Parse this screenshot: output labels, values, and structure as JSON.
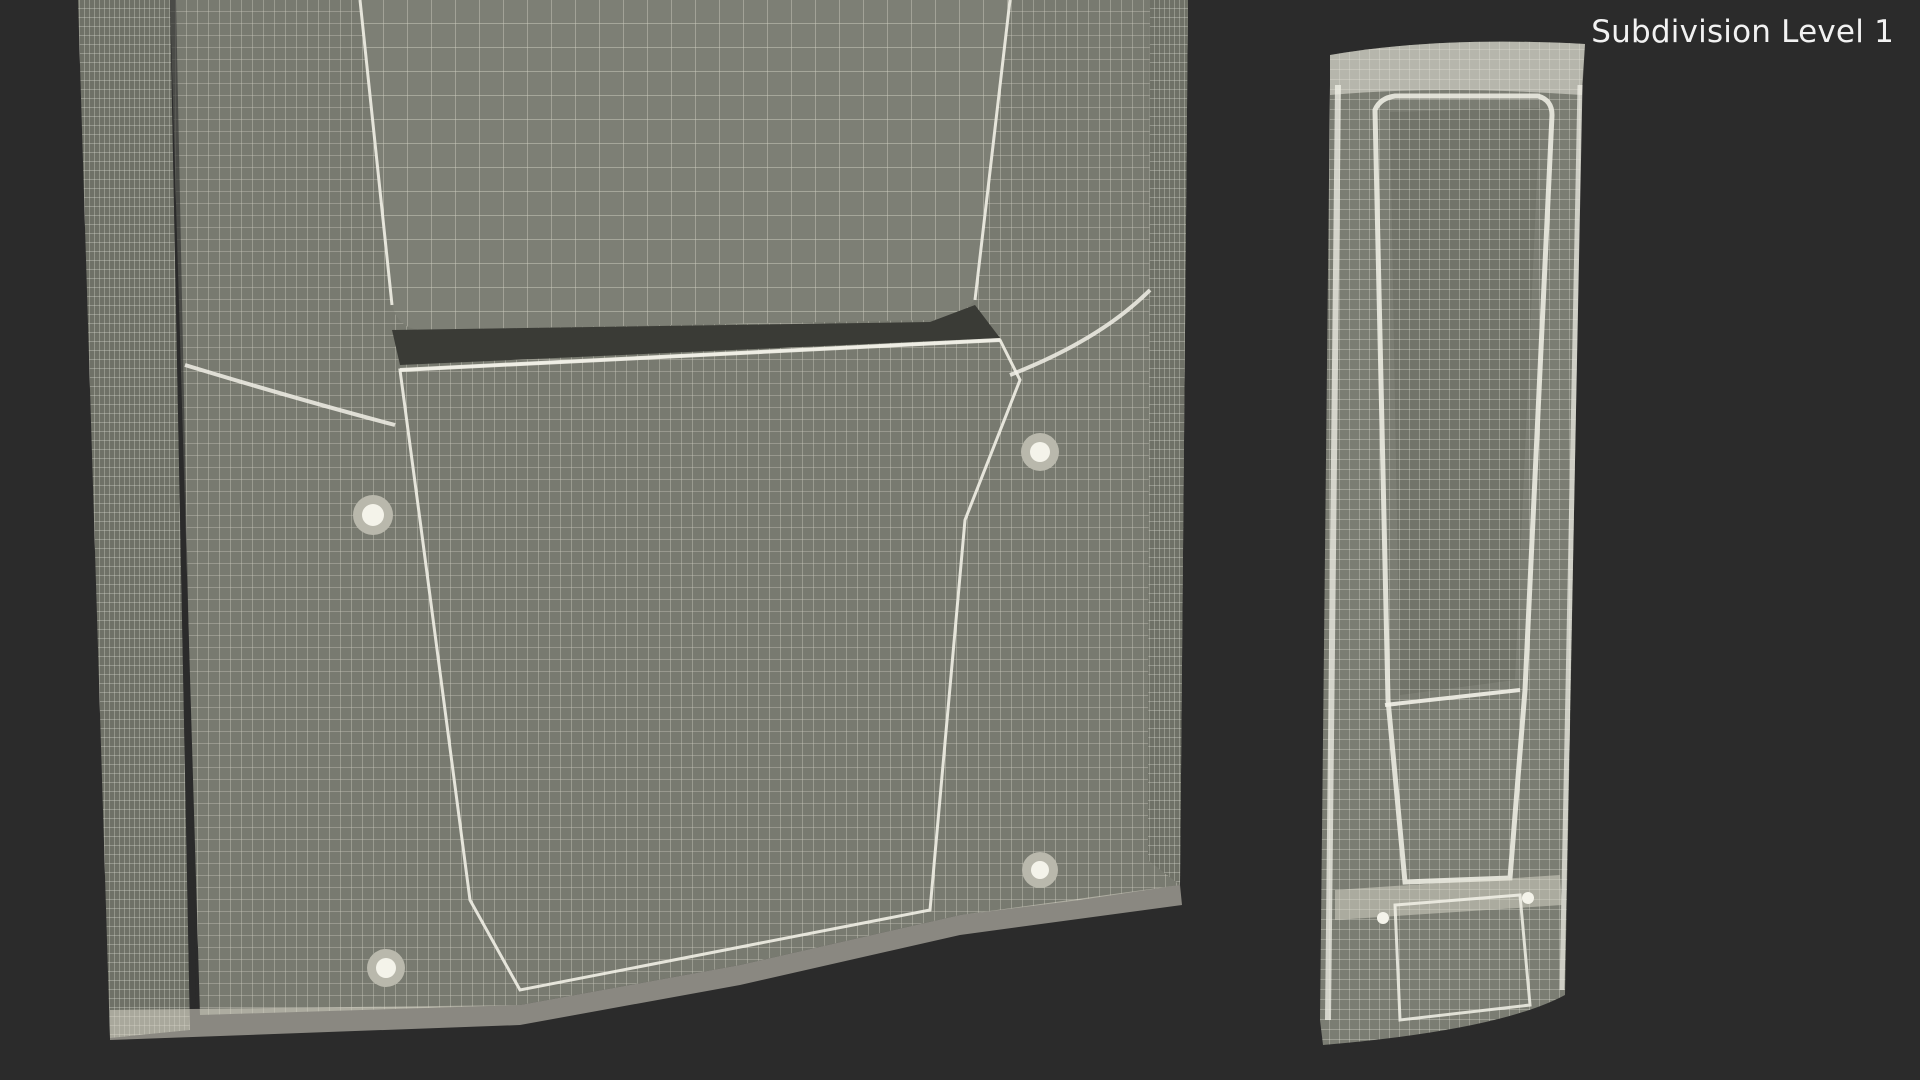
{
  "caption": "Subdivision Level 1"
}
